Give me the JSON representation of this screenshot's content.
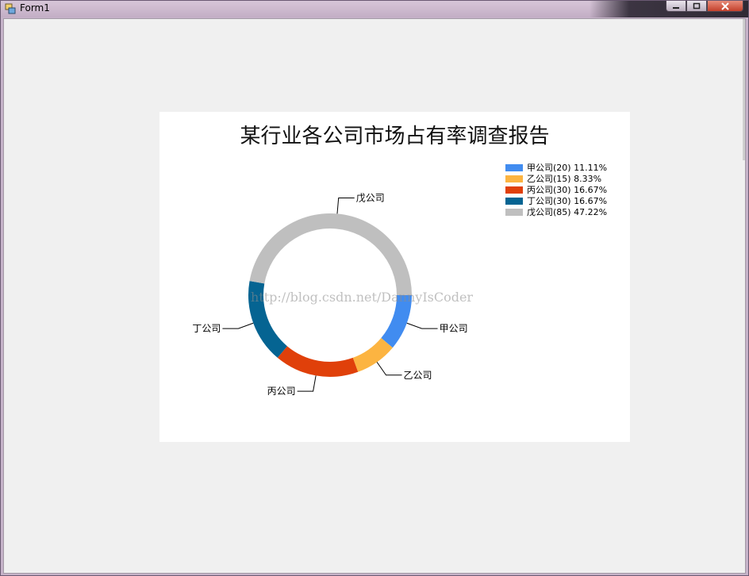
{
  "window": {
    "title": "Form1"
  },
  "chart_data": {
    "type": "pie",
    "title": "某行业各公司市场占有率调查报告",
    "categories": [
      "甲公司",
      "乙公司",
      "丙公司",
      "丁公司",
      "戊公司"
    ],
    "values": [
      20,
      15,
      30,
      30,
      85
    ],
    "percentages": [
      "11.11%",
      "8.33%",
      "16.67%",
      "16.67%",
      "47.22%"
    ],
    "legend": [
      "甲公司(20) 11.11%",
      "乙公司(15) 8.33%",
      "丙公司(30) 16.67%",
      "丁公司(30) 16.67%",
      "戊公司(85) 47.22%"
    ],
    "colors": [
      "#418cf0",
      "#fcb441",
      "#e0400a",
      "#056492",
      "#bfbfbf"
    ],
    "style": "doughnut",
    "legend_position": "top-right"
  },
  "watermark": "http://blog.csdn.net/DannyIsCoder"
}
